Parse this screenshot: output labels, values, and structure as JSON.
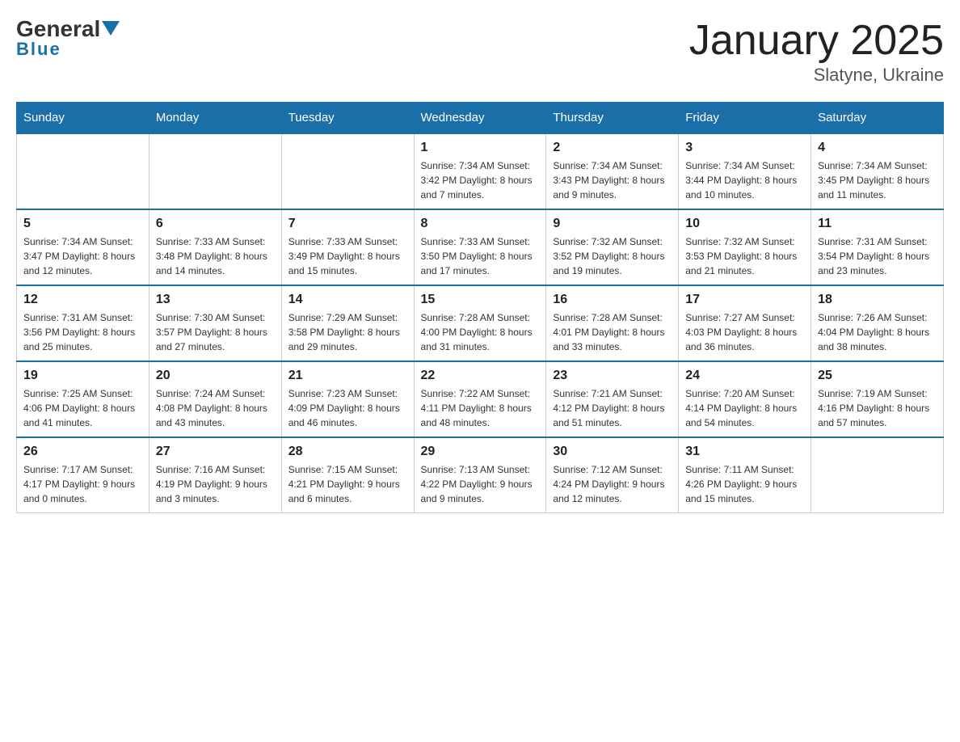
{
  "header": {
    "logo": {
      "general": "General",
      "blue": "Blue"
    },
    "title": "January 2025",
    "location": "Slatyne, Ukraine"
  },
  "days_of_week": [
    "Sunday",
    "Monday",
    "Tuesday",
    "Wednesday",
    "Thursday",
    "Friday",
    "Saturday"
  ],
  "weeks": [
    [
      {
        "day": "",
        "info": ""
      },
      {
        "day": "",
        "info": ""
      },
      {
        "day": "",
        "info": ""
      },
      {
        "day": "1",
        "info": "Sunrise: 7:34 AM\nSunset: 3:42 PM\nDaylight: 8 hours and 7 minutes."
      },
      {
        "day": "2",
        "info": "Sunrise: 7:34 AM\nSunset: 3:43 PM\nDaylight: 8 hours and 9 minutes."
      },
      {
        "day": "3",
        "info": "Sunrise: 7:34 AM\nSunset: 3:44 PM\nDaylight: 8 hours and 10 minutes."
      },
      {
        "day": "4",
        "info": "Sunrise: 7:34 AM\nSunset: 3:45 PM\nDaylight: 8 hours and 11 minutes."
      }
    ],
    [
      {
        "day": "5",
        "info": "Sunrise: 7:34 AM\nSunset: 3:47 PM\nDaylight: 8 hours and 12 minutes."
      },
      {
        "day": "6",
        "info": "Sunrise: 7:33 AM\nSunset: 3:48 PM\nDaylight: 8 hours and 14 minutes."
      },
      {
        "day": "7",
        "info": "Sunrise: 7:33 AM\nSunset: 3:49 PM\nDaylight: 8 hours and 15 minutes."
      },
      {
        "day": "8",
        "info": "Sunrise: 7:33 AM\nSunset: 3:50 PM\nDaylight: 8 hours and 17 minutes."
      },
      {
        "day": "9",
        "info": "Sunrise: 7:32 AM\nSunset: 3:52 PM\nDaylight: 8 hours and 19 minutes."
      },
      {
        "day": "10",
        "info": "Sunrise: 7:32 AM\nSunset: 3:53 PM\nDaylight: 8 hours and 21 minutes."
      },
      {
        "day": "11",
        "info": "Sunrise: 7:31 AM\nSunset: 3:54 PM\nDaylight: 8 hours and 23 minutes."
      }
    ],
    [
      {
        "day": "12",
        "info": "Sunrise: 7:31 AM\nSunset: 3:56 PM\nDaylight: 8 hours and 25 minutes."
      },
      {
        "day": "13",
        "info": "Sunrise: 7:30 AM\nSunset: 3:57 PM\nDaylight: 8 hours and 27 minutes."
      },
      {
        "day": "14",
        "info": "Sunrise: 7:29 AM\nSunset: 3:58 PM\nDaylight: 8 hours and 29 minutes."
      },
      {
        "day": "15",
        "info": "Sunrise: 7:28 AM\nSunset: 4:00 PM\nDaylight: 8 hours and 31 minutes."
      },
      {
        "day": "16",
        "info": "Sunrise: 7:28 AM\nSunset: 4:01 PM\nDaylight: 8 hours and 33 minutes."
      },
      {
        "day": "17",
        "info": "Sunrise: 7:27 AM\nSunset: 4:03 PM\nDaylight: 8 hours and 36 minutes."
      },
      {
        "day": "18",
        "info": "Sunrise: 7:26 AM\nSunset: 4:04 PM\nDaylight: 8 hours and 38 minutes."
      }
    ],
    [
      {
        "day": "19",
        "info": "Sunrise: 7:25 AM\nSunset: 4:06 PM\nDaylight: 8 hours and 41 minutes."
      },
      {
        "day": "20",
        "info": "Sunrise: 7:24 AM\nSunset: 4:08 PM\nDaylight: 8 hours and 43 minutes."
      },
      {
        "day": "21",
        "info": "Sunrise: 7:23 AM\nSunset: 4:09 PM\nDaylight: 8 hours and 46 minutes."
      },
      {
        "day": "22",
        "info": "Sunrise: 7:22 AM\nSunset: 4:11 PM\nDaylight: 8 hours and 48 minutes."
      },
      {
        "day": "23",
        "info": "Sunrise: 7:21 AM\nSunset: 4:12 PM\nDaylight: 8 hours and 51 minutes."
      },
      {
        "day": "24",
        "info": "Sunrise: 7:20 AM\nSunset: 4:14 PM\nDaylight: 8 hours and 54 minutes."
      },
      {
        "day": "25",
        "info": "Sunrise: 7:19 AM\nSunset: 4:16 PM\nDaylight: 8 hours and 57 minutes."
      }
    ],
    [
      {
        "day": "26",
        "info": "Sunrise: 7:17 AM\nSunset: 4:17 PM\nDaylight: 9 hours and 0 minutes."
      },
      {
        "day": "27",
        "info": "Sunrise: 7:16 AM\nSunset: 4:19 PM\nDaylight: 9 hours and 3 minutes."
      },
      {
        "day": "28",
        "info": "Sunrise: 7:15 AM\nSunset: 4:21 PM\nDaylight: 9 hours and 6 minutes."
      },
      {
        "day": "29",
        "info": "Sunrise: 7:13 AM\nSunset: 4:22 PM\nDaylight: 9 hours and 9 minutes."
      },
      {
        "day": "30",
        "info": "Sunrise: 7:12 AM\nSunset: 4:24 PM\nDaylight: 9 hours and 12 minutes."
      },
      {
        "day": "31",
        "info": "Sunrise: 7:11 AM\nSunset: 4:26 PM\nDaylight: 9 hours and 15 minutes."
      },
      {
        "day": "",
        "info": ""
      }
    ]
  ]
}
